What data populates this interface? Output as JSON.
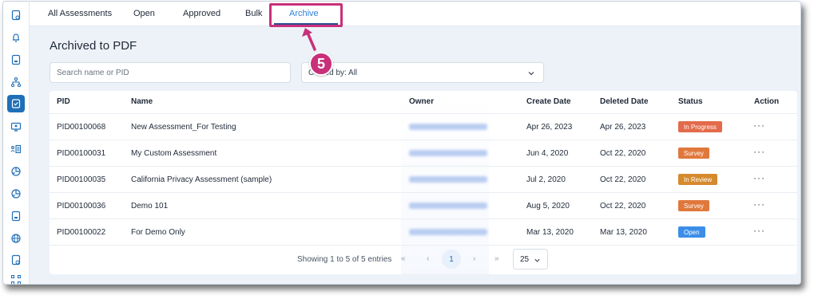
{
  "tabs": [
    {
      "label": "All Assessments"
    },
    {
      "label": "Open"
    },
    {
      "label": "Approved"
    },
    {
      "label": "Bulk"
    },
    {
      "label": "Archive",
      "active": true
    }
  ],
  "annotation": {
    "step": "5",
    "color": "#c8307a"
  },
  "page_title": "Archived to PDF",
  "search": {
    "placeholder": "Search name or PID"
  },
  "filter": {
    "visible_label": "C",
    "value_visible": "ated by: All"
  },
  "table": {
    "columns": [
      "PID",
      "Name",
      "Owner",
      "Create Date",
      "Deleted Date",
      "Status",
      "Action"
    ],
    "rows": [
      {
        "pid": "PID00100068",
        "name": "New Assessment_For Testing",
        "create": "Apr 26, 2023",
        "deleted": "Apr 26, 2023",
        "status": "In Progress"
      },
      {
        "pid": "PID00100031",
        "name": "My Custom Assessment",
        "create": "Jun 4, 2020",
        "deleted": "Oct 22, 2020",
        "status": "Survey"
      },
      {
        "pid": "PID00100035",
        "name": "California Privacy Assessment (sample)",
        "create": "Jul 2, 2020",
        "deleted": "Oct 22, 2020",
        "status": "In Review"
      },
      {
        "pid": "PID00100036",
        "name": "Demo 101",
        "create": "Aug 5, 2020",
        "deleted": "Oct 22, 2020",
        "status": "Survey"
      },
      {
        "pid": "PID00100022",
        "name": "For Demo Only",
        "create": "Mar 13, 2020",
        "deleted": "Mar 13, 2020",
        "status": "Open"
      }
    ],
    "action_glyph": "···"
  },
  "pagination": {
    "info": "Showing 1 to 5 of 5 entries",
    "first": "«",
    "prev": "‹",
    "current": "1",
    "next": "›",
    "last": "»",
    "page_size": "25"
  },
  "colors": {
    "accent": "#1f6fb8",
    "in_progress": "#e36b4b",
    "survey": "#e0783c",
    "in_review": "#d68a2e",
    "open": "#3b8ee8"
  },
  "sidebar_icons": [
    "document-icon",
    "bell-icon",
    "document-icon",
    "network-icon",
    "checklist-icon",
    "monitor-icon",
    "list-user-icon",
    "globe-chart-icon",
    "globe-chart-icon",
    "document-icon",
    "globe-icon",
    "document-icon",
    "nodes-icon"
  ]
}
